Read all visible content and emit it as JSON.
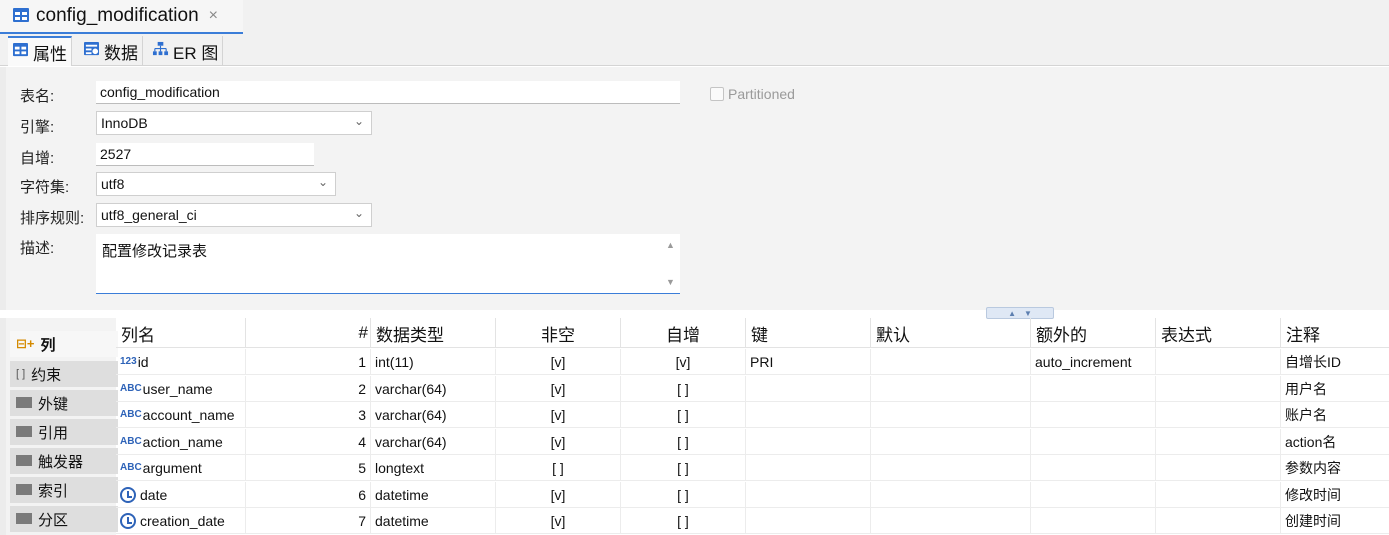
{
  "editor_tab": {
    "title": "config_modification",
    "close": "×"
  },
  "subtabs": [
    {
      "label": "属性",
      "icon": "table-icon"
    },
    {
      "label": "数据",
      "icon": "data-grid-icon"
    },
    {
      "label": "ER 图",
      "icon": "er-diagram-icon"
    }
  ],
  "props": {
    "table_name_label": "表名:",
    "table_name_value": "config_modification",
    "partitioned_label": "Partitioned",
    "partitioned_checked": false,
    "engine_label": "引擎:",
    "engine_value": "InnoDB",
    "auto_inc_label": "自增:",
    "auto_inc_value": "2527",
    "charset_label": "字符集:",
    "charset_value": "utf8",
    "collation_label": "排序规则:",
    "collation_value": "utf8_general_ci",
    "desc_label": "描述:",
    "desc_value": "配置修改记录表"
  },
  "sidenav": [
    {
      "label": "列",
      "icon": "columns-icon",
      "active": true
    },
    {
      "label": "约束",
      "icon": "constraint-icon"
    },
    {
      "label": "外键",
      "icon": "folder-icon"
    },
    {
      "label": "引用",
      "icon": "folder-icon"
    },
    {
      "label": "触发器",
      "icon": "folder-icon"
    },
    {
      "label": "索引",
      "icon": "folder-icon"
    },
    {
      "label": "分区",
      "icon": "folder-icon"
    }
  ],
  "table": {
    "headers": {
      "name": "列名",
      "num": "#",
      "type": "数据类型",
      "notnull": "非空",
      "autoinc": "自增",
      "key": "键",
      "default": "默认",
      "extra": "额外的",
      "expr": "表达式",
      "comment": "注释"
    },
    "rows": [
      {
        "icon": "123",
        "name": "id",
        "num": "1",
        "type": "int(11)",
        "notnull": "[v]",
        "autoinc": "[v]",
        "key": "PRI",
        "default": "",
        "extra": "auto_increment",
        "expr": "",
        "comment": "自增长ID"
      },
      {
        "icon": "ABC",
        "name": "user_name",
        "num": "2",
        "type": "varchar(64)",
        "notnull": "[v]",
        "autoinc": "[ ]",
        "key": "",
        "default": "",
        "extra": "",
        "expr": "",
        "comment": "用户名"
      },
      {
        "icon": "ABC",
        "name": "account_name",
        "num": "3",
        "type": "varchar(64)",
        "notnull": "[v]",
        "autoinc": "[ ]",
        "key": "",
        "default": "",
        "extra": "",
        "expr": "",
        "comment": "账户名"
      },
      {
        "icon": "ABC",
        "name": "action_name",
        "num": "4",
        "type": "varchar(64)",
        "notnull": "[v]",
        "autoinc": "[ ]",
        "key": "",
        "default": "",
        "extra": "",
        "expr": "",
        "comment": "action名"
      },
      {
        "icon": "ABC",
        "name": "argument",
        "num": "5",
        "type": "longtext",
        "notnull": "[ ]",
        "autoinc": "[ ]",
        "key": "",
        "default": "",
        "extra": "",
        "expr": "",
        "comment": "参数内容"
      },
      {
        "icon": "clock",
        "name": "date",
        "num": "6",
        "type": "datetime",
        "notnull": "[v]",
        "autoinc": "[ ]",
        "key": "",
        "default": "",
        "extra": "",
        "expr": "",
        "comment": "修改时间"
      },
      {
        "icon": "clock",
        "name": "creation_date",
        "num": "7",
        "type": "datetime",
        "notnull": "[v]",
        "autoinc": "[ ]",
        "key": "",
        "default": "",
        "extra": "",
        "expr": "",
        "comment": "创建时间"
      }
    ]
  },
  "colors": {
    "accent": "#3b7dd8",
    "icon_blue": "#2e63b8"
  }
}
